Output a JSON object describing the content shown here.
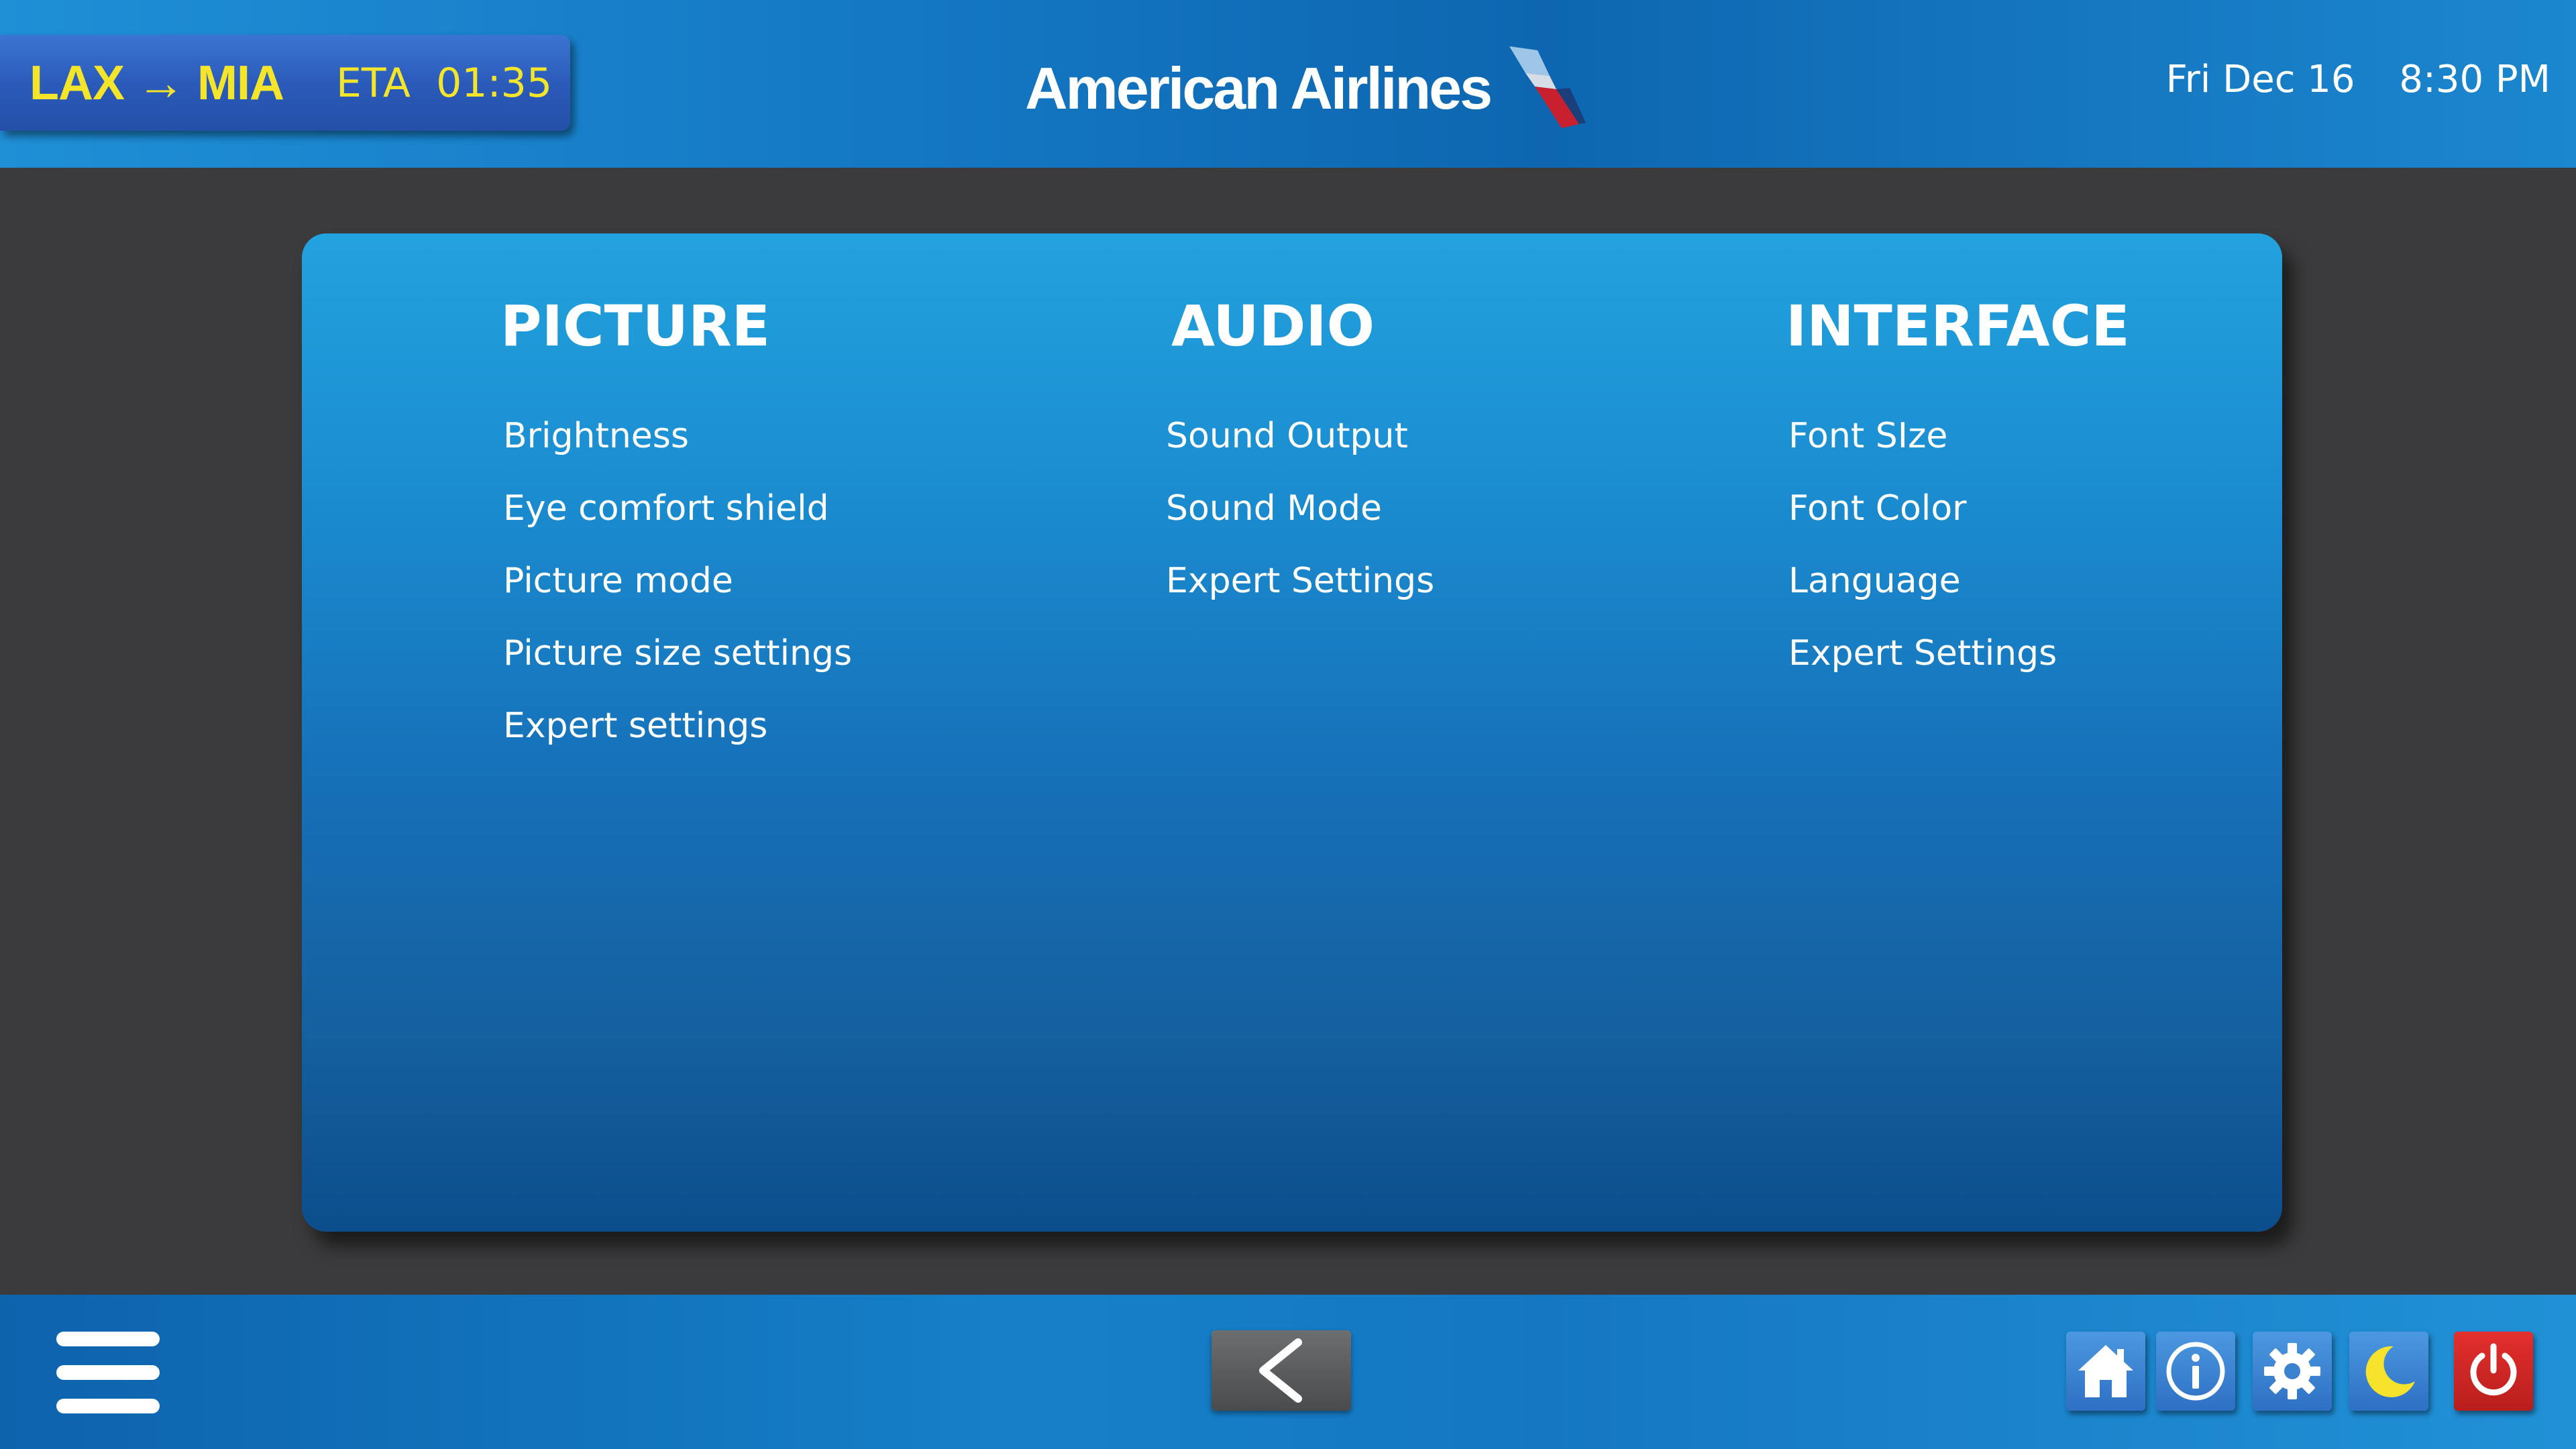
{
  "header": {
    "route": "LAX → MIA",
    "eta_label": "ETA",
    "eta_time": "01:35",
    "airline": "American Airlines",
    "date": "Fri Dec 16",
    "time": "8:30 PM"
  },
  "settings": {
    "columns": [
      {
        "title": "PICTURE",
        "items": [
          "Brightness",
          "Eye comfort shield",
          "Picture mode",
          "Picture size settings",
          "Expert settings"
        ]
      },
      {
        "title": "AUDIO",
        "items": [
          "Sound Output",
          "Sound Mode",
          "Expert Settings"
        ]
      },
      {
        "title": "INTERFACE",
        "items": [
          "Font SIze",
          "Font Color",
          "Language",
          "Expert Settings"
        ]
      }
    ]
  },
  "footer": {
    "icons": [
      "menu-icon",
      "back-arrow-icon",
      "home-icon",
      "info-icon",
      "gear-icon",
      "moon-icon",
      "power-icon"
    ]
  },
  "colors": {
    "accent_yellow": "#f5e52a",
    "header_blue": "#1478c4",
    "panel_blue": "#1b8dd1",
    "power_red": "#d12a28"
  }
}
